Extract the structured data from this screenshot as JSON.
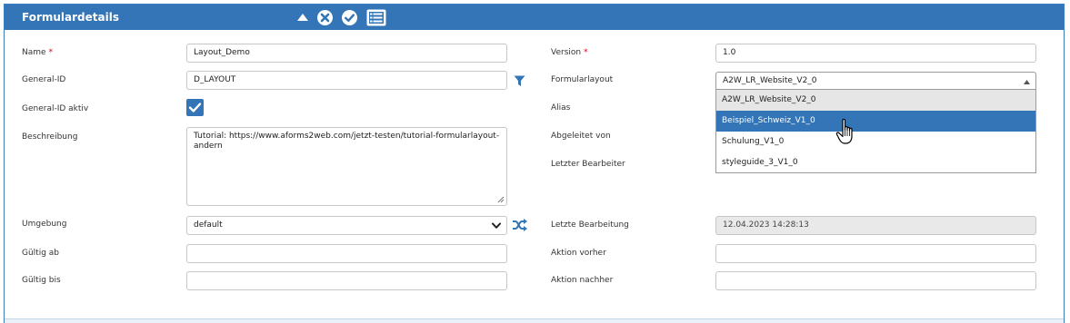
{
  "panel": {
    "title": "Formulardetails",
    "header_icons": [
      "collapse-up-icon",
      "close-circle-icon",
      "check-circle-icon",
      "list-view-icon"
    ]
  },
  "left": {
    "name": {
      "label": "Name",
      "required": "*",
      "value": "Layout_Demo"
    },
    "general_id": {
      "label": "General-ID",
      "value": "D_LAYOUT"
    },
    "general_id_active": {
      "label": "General-ID aktiv",
      "checked": true
    },
    "description": {
      "label": "Beschreibung",
      "value": "Tutorial: https://www.aforms2web.com/jetzt-testen/tutorial-formularlayout-andern"
    },
    "environment": {
      "label": "Umgebung",
      "value": "default"
    },
    "valid_from": {
      "label": "Gültig ab",
      "value": ""
    },
    "valid_until": {
      "label": "Gültig bis",
      "value": ""
    }
  },
  "right": {
    "version": {
      "label": "Version",
      "required": "*",
      "value": "1.0"
    },
    "form_layout": {
      "label": "Formularlayout",
      "value": "A2W_LR_Website_V2_0",
      "options": [
        "A2W_LR_Website_V2_0",
        "Beispiel_Schweiz_V1_0",
        "Schulung_V1_0",
        "styleguide_3_V1_0"
      ],
      "highlighted_option": "Beispiel_Schweiz_V1_0"
    },
    "alias": {
      "label": "Alias"
    },
    "derived_from": {
      "label": "Abgeleitet von"
    },
    "last_editor": {
      "label": "Letzter Bearbeiter"
    },
    "last_edit": {
      "label": "Letzte Bearbeitung",
      "value": "12.04.2023 14:28:13"
    },
    "action_before": {
      "label": "Aktion vorher",
      "value": ""
    },
    "action_after": {
      "label": "Aktion nachher",
      "value": ""
    }
  },
  "colors": {
    "header_bg": "#3375b7",
    "selected_option_bg": "#3375b7",
    "required_star": "#d0021b"
  }
}
